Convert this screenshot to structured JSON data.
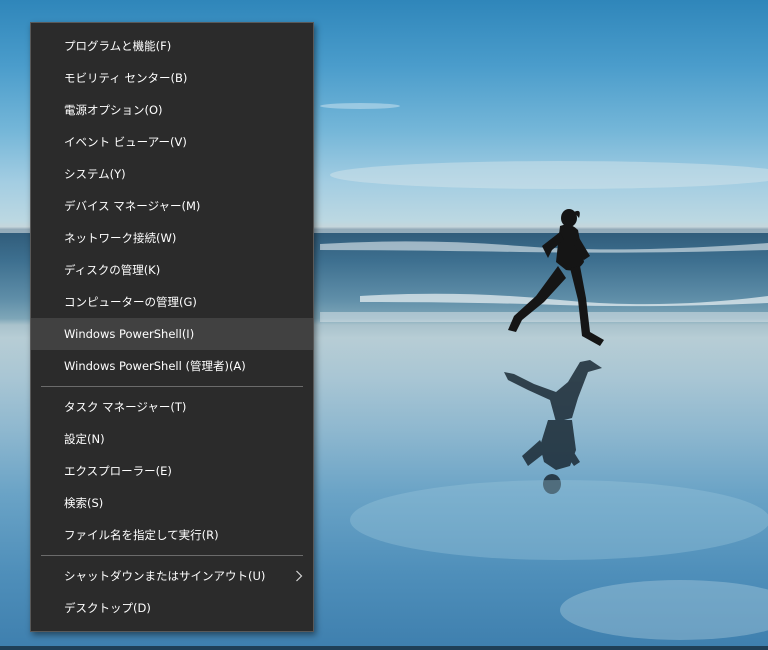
{
  "menu": {
    "group1": [
      {
        "label": "プログラムと機能(F)"
      },
      {
        "label": "モビリティ センター(B)"
      },
      {
        "label": "電源オプション(O)"
      },
      {
        "label": "イベント ビューアー(V)"
      },
      {
        "label": "システム(Y)"
      },
      {
        "label": "デバイス マネージャー(M)"
      },
      {
        "label": "ネットワーク接続(W)"
      },
      {
        "label": "ディスクの管理(K)"
      },
      {
        "label": "コンピューターの管理(G)"
      },
      {
        "label": "Windows PowerShell(I)"
      },
      {
        "label": "Windows PowerShell (管理者)(A)"
      }
    ],
    "group2": [
      {
        "label": "タスク マネージャー(T)"
      },
      {
        "label": "設定(N)"
      },
      {
        "label": "エクスプローラー(E)"
      },
      {
        "label": "検索(S)"
      },
      {
        "label": "ファイル名を指定して実行(R)"
      }
    ],
    "group3": [
      {
        "label": "シャットダウンまたはサインアウト(U)"
      },
      {
        "label": "デスクトップ(D)"
      }
    ],
    "hovered_item": "Windows PowerShell(I)",
    "colors": {
      "background": "#2b2b2b",
      "hover": "#414141",
      "text": "#ffffff",
      "separator": "#6b6b6b"
    }
  },
  "icons": {
    "submenu": "chevron-right-icon"
  }
}
